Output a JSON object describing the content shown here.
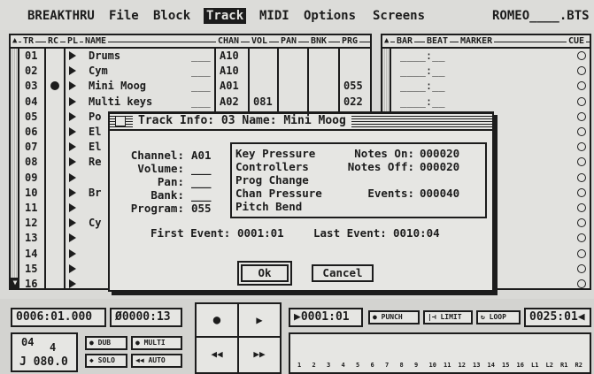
{
  "menubar": {
    "items": [
      "BREAKTHRU",
      "File",
      "Block",
      "Track",
      "MIDI",
      "Options",
      "Screens"
    ],
    "active": "Track",
    "filename": "ROMEO____.BTS"
  },
  "track_table": {
    "headers": {
      "tr": "TR",
      "rc": "RC",
      "pl": "PL",
      "name": "NAME",
      "chan": "CHAN",
      "vol": "VOL",
      "pan": "PAN",
      "bnk": "BNK",
      "prg": "PRG"
    },
    "rows": [
      {
        "num": "01",
        "name": "Drums",
        "chan": "A10",
        "vol": "",
        "prg": "",
        "rec": false
      },
      {
        "num": "02",
        "name": "Cym",
        "chan": "A10",
        "vol": "",
        "prg": "",
        "rec": false
      },
      {
        "num": "03",
        "name": "Mini Moog",
        "chan": "A01",
        "vol": "",
        "prg": "055",
        "rec": true
      },
      {
        "num": "04",
        "name": "Multi keys",
        "chan": "A02",
        "vol": "081",
        "prg": "022",
        "rec": false
      },
      {
        "num": "05",
        "name": "Po",
        "chan": "",
        "vol": "",
        "prg": "",
        "rec": false
      },
      {
        "num": "06",
        "name": "El",
        "chan": "",
        "vol": "",
        "prg": "",
        "rec": false
      },
      {
        "num": "07",
        "name": "El",
        "chan": "",
        "vol": "",
        "prg": "",
        "rec": false
      },
      {
        "num": "08",
        "name": "Re",
        "chan": "",
        "vol": "",
        "prg": "",
        "rec": false
      },
      {
        "num": "09",
        "name": "",
        "chan": "",
        "vol": "",
        "prg": "",
        "rec": false
      },
      {
        "num": "10",
        "name": "Br",
        "chan": "",
        "vol": "",
        "prg": "",
        "rec": false
      },
      {
        "num": "11",
        "name": "",
        "chan": "",
        "vol": "",
        "prg": "",
        "rec": false
      },
      {
        "num": "12",
        "name": "Cy",
        "chan": "",
        "vol": "",
        "prg": "",
        "rec": false
      },
      {
        "num": "13",
        "name": "",
        "chan": "",
        "vol": "",
        "prg": "",
        "rec": false
      },
      {
        "num": "14",
        "name": "",
        "chan": "",
        "vol": "",
        "prg": "",
        "rec": false
      },
      {
        "num": "15",
        "name": "",
        "chan": "",
        "vol": "",
        "prg": "",
        "rec": false
      },
      {
        "num": "16",
        "name": "",
        "chan": "",
        "vol": "",
        "prg": "",
        "rec": false
      }
    ]
  },
  "cue_table": {
    "headers": {
      "bar": "BAR",
      "beat": "BEAT",
      "marker": "MARKER",
      "cue": "CUE"
    },
    "row_count": 16
  },
  "dialog": {
    "title": "Track Info: 03  Name: Mini Moog",
    "channel_label": "Channel:",
    "channel_value": "A01",
    "volume_label": "Volume:",
    "volume_value": "___",
    "pan_label": "Pan:",
    "pan_value": "___",
    "bank_label": "Bank:",
    "bank_value": "___",
    "program_label": "Program:",
    "program_value": "055",
    "event_types": [
      "Key Pressure",
      "Controllers",
      "Prog Change",
      "Chan Pressure",
      "Pitch Bend"
    ],
    "notes_on_label": "Notes On:",
    "notes_on_value": "000020",
    "notes_off_label": "Notes Off:",
    "notes_off_value": "000020",
    "events_label": "Events:",
    "events_value": "000040",
    "first_event_label": "First Event:",
    "first_event_value": "0001:01",
    "last_event_label": "Last Event:",
    "last_event_value": "0010:04",
    "ok_label": "Ok",
    "cancel_label": "Cancel"
  },
  "transport": {
    "position": "0006:01.000",
    "time": "Ø0000:13",
    "locator": "0001:01",
    "end_locator": "0025:01",
    "time_sig_top": "04",
    "time_sig_bottom": "4",
    "tempo": "J 080.0",
    "dub_label": "DUB",
    "multi_label": "MULTI",
    "solo_label": "SOLO",
    "auto_label": "AUTO",
    "punch_label": "PUNCH",
    "limit_label": "LIMIT",
    "loop_label": "LOOP",
    "track_numbers": [
      "1",
      "2",
      "3",
      "4",
      "5",
      "6",
      "7",
      "8",
      "9",
      "10",
      "11",
      "12",
      "13",
      "14",
      "15",
      "16",
      "L1",
      "L2",
      "R1",
      "R2"
    ]
  }
}
